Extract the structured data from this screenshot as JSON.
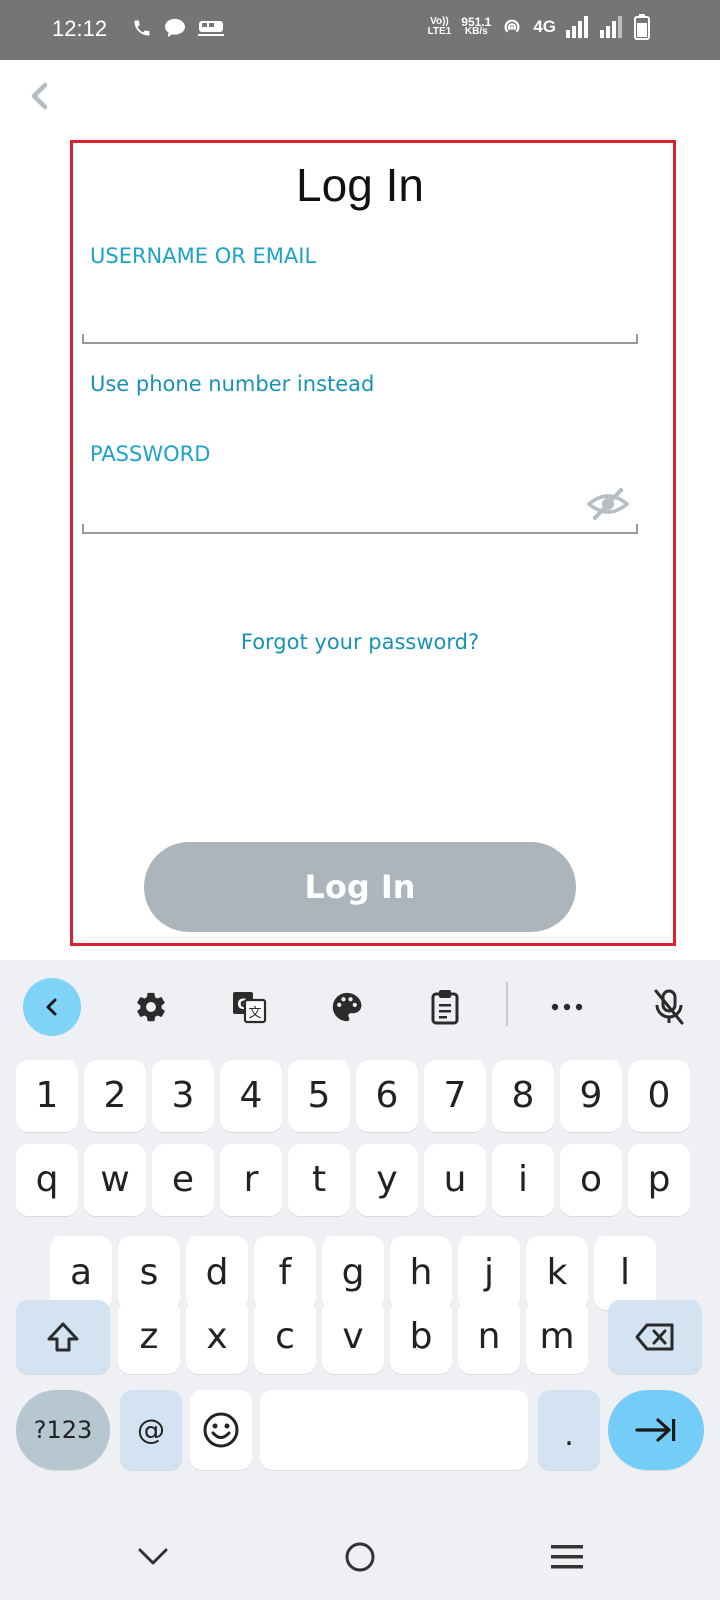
{
  "status_bar": {
    "time": "12:12",
    "volte": "Vo))",
    "lte": "LTE1",
    "speed": "951.1",
    "speed_unit": "KB/s",
    "network": "4G"
  },
  "form": {
    "title": "Log In",
    "username_label": "USERNAME OR EMAIL",
    "username_value": "",
    "phone_link": "Use phone number instead",
    "password_label": "PASSWORD",
    "password_value": "",
    "forgot_link": "Forgot your password?",
    "login_button": "Log In"
  },
  "colors": {
    "accent": "#1ea2c8",
    "highlight": "#d9232f",
    "button_disabled": "#adb5bc",
    "enter_key": "#73cdf7"
  },
  "keyboard": {
    "toolbar": [
      "collapse-icon",
      "gear-icon",
      "translate-icon",
      "palette-icon",
      "clipboard-icon",
      "more-icon",
      "mic-off-icon"
    ],
    "row_numbers": [
      "1",
      "2",
      "3",
      "4",
      "5",
      "6",
      "7",
      "8",
      "9",
      "0"
    ],
    "row_top": [
      "q",
      "w",
      "e",
      "r",
      "t",
      "y",
      "u",
      "i",
      "o",
      "p"
    ],
    "row_middle": [
      "a",
      "s",
      "d",
      "f",
      "g",
      "h",
      "j",
      "k",
      "l"
    ],
    "row_bottom": [
      "z",
      "x",
      "c",
      "v",
      "b",
      "n",
      "m"
    ],
    "symbols_key": "?123",
    "at_key": "@",
    "period_key": "."
  },
  "nav_bar": [
    "back-chevron-icon",
    "home-icon",
    "recents-icon"
  ]
}
